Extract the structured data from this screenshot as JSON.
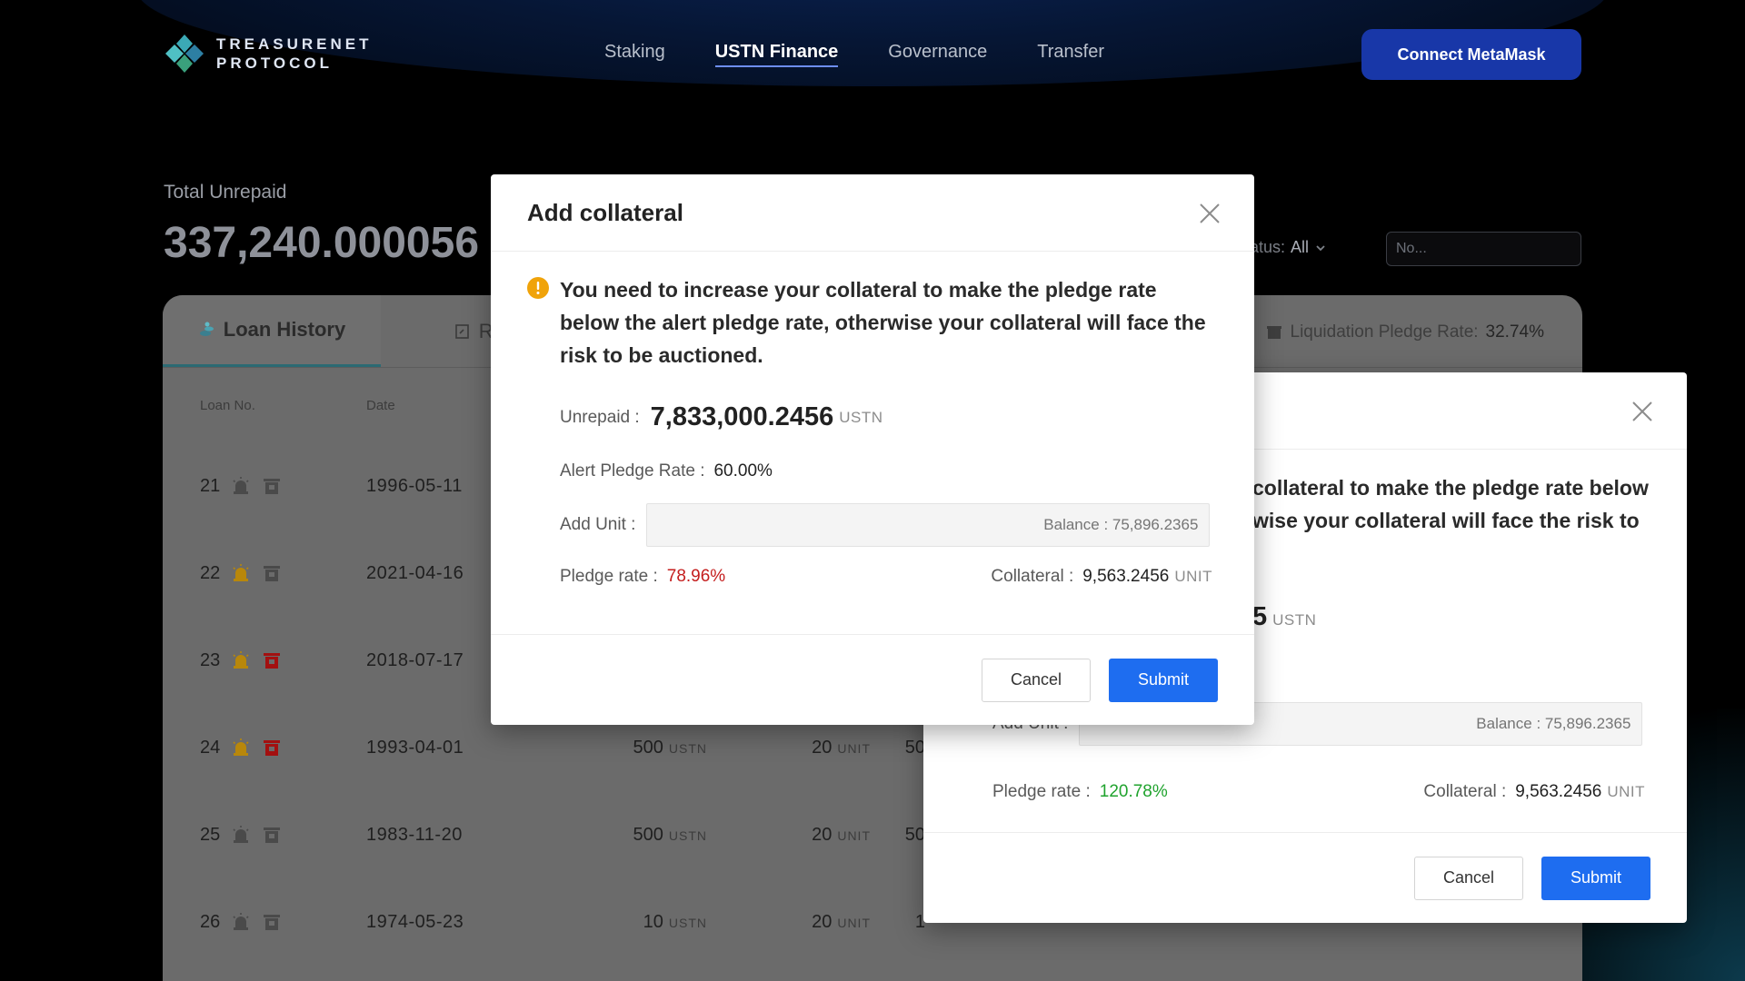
{
  "header": {
    "logo_line1": "TREASURENET",
    "logo_line2": "PROTOCOL",
    "nav": [
      "Staking",
      "USTN Finance",
      "Governance",
      "Transfer"
    ],
    "connect_label": "Connect MetaMask"
  },
  "summary": {
    "label": "Total Unrepaid",
    "value": "337,240.000056",
    "status_label": "atus:",
    "status_value": "All",
    "search_placeholder": "No..."
  },
  "panel": {
    "tabs": [
      "Loan History",
      "Repa"
    ],
    "liquidation_label": "Liquidation Pledge Rate:",
    "liquidation_value": "32.74%",
    "columns": {
      "loan_no": "Loan No.",
      "date": "Date"
    },
    "rows": [
      {
        "no": "21",
        "date": "1996-05-11",
        "amount": "",
        "amount_unit": "",
        "collateral": "",
        "collateral_unit": "",
        "tail": "",
        "alarm": "normal",
        "trash": "normal"
      },
      {
        "no": "22",
        "date": "2021-04-16",
        "amount": "",
        "amount_unit": "",
        "collateral": "",
        "collateral_unit": "",
        "tail": "",
        "alarm": "warn",
        "trash": "normal"
      },
      {
        "no": "23",
        "date": "2018-07-17",
        "amount": "",
        "amount_unit": "",
        "collateral": "",
        "collateral_unit": "",
        "tail": "",
        "alarm": "warn",
        "trash": "danger"
      },
      {
        "no": "24",
        "date": "1993-04-01",
        "amount": "500",
        "amount_unit": "USTN",
        "collateral": "20",
        "collateral_unit": "UNIT",
        "tail": "50",
        "alarm": "warn",
        "trash": "danger"
      },
      {
        "no": "25",
        "date": "1983-11-20",
        "amount": "500",
        "amount_unit": "USTN",
        "collateral": "20",
        "collateral_unit": "UNIT",
        "tail": "50",
        "alarm": "normal",
        "trash": "normal"
      },
      {
        "no": "26",
        "date": "1974-05-23",
        "amount": "10",
        "amount_unit": "USTN",
        "collateral": "20",
        "collateral_unit": "UNIT",
        "tail": "1",
        "alarm": "normal",
        "trash": "normal"
      }
    ]
  },
  "modal_front": {
    "title": "Add collateral",
    "warning": "You need to increase your collateral to make the pledge rate below the alert pledge rate, otherwise your collateral will face the risk to be auctioned.",
    "unpaid_label": "Unrepaid :",
    "unpaid_value": "7,833,000.2456",
    "unpaid_unit": "USTN",
    "alert_label": "Alert Pledge Rate :",
    "alert_value": "60.00%",
    "add_unit_label": "Add Unit :",
    "balance_placeholder": "Balance : 75,896.2365",
    "pledge_label": "Pledge rate :",
    "pledge_value": "78.96%",
    "collateral_label": "Collateral :",
    "collateral_value": "9,563.2456",
    "collateral_unit": "UNIT",
    "cancel_label": "Cancel",
    "submit_label": "Submit"
  },
  "modal_back": {
    "warning_line1": "collateral to make the pledge rate below",
    "warning_line2": "wise your collateral will face the risk to",
    "unpaid_partial": "5",
    "unpaid_unit": "USTN",
    "add_unit_label": "Add Unit :",
    "balance_placeholder": "Balance : 75,896.2365",
    "pledge_label": "Pledge rate :",
    "pledge_value": "120.78%",
    "collateral_label": "Collateral :",
    "collateral_value": "9,563.2456",
    "collateral_unit": "UNIT",
    "cancel_label": "Cancel",
    "submit_label": "Submit"
  },
  "colors": {
    "accent": "#1e6df0",
    "connect_button": "#1837a8",
    "danger": "#c41d1d",
    "success": "#20a32e",
    "warning_icon": "#f0a30a"
  }
}
